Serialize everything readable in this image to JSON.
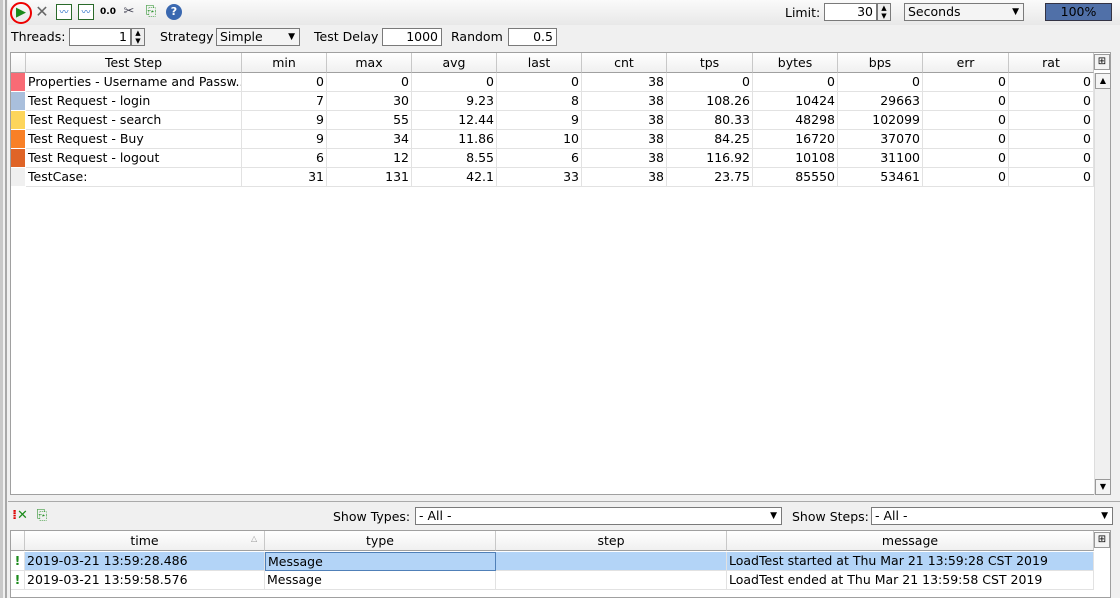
{
  "toolbar": {
    "icons": [
      "run-icon",
      "cancel-icon",
      "statistics-graph-icon",
      "statistics-history-icon",
      "reset-icon",
      "options-icon",
      "export-icon",
      "help-icon"
    ],
    "reset_label": "0.0",
    "limit_label": "Limit:",
    "limit_value": "30",
    "limit_unit": "Seconds",
    "progress": "100%",
    "progress_value": 100
  },
  "settings": {
    "threads_label": "Threads:",
    "threads": "1",
    "strategy_label": "Strategy",
    "strategy": "Simple",
    "delay_label": "Test Delay",
    "delay": "1000",
    "random_label": "Random",
    "random": "0.5"
  },
  "stats": {
    "columns": [
      "Test Step",
      "min",
      "max",
      "avg",
      "last",
      "cnt",
      "tps",
      "bytes",
      "bps",
      "err",
      "rat"
    ],
    "rows": [
      {
        "color": "#f86b75",
        "cells": [
          "Properties - Username and Passw...",
          "0",
          "0",
          "0",
          "0",
          "38",
          "0",
          "0",
          "0",
          "0",
          "0"
        ]
      },
      {
        "color": "#a9bfdc",
        "cells": [
          "Test Request - login",
          "7",
          "30",
          "9.23",
          "8",
          "38",
          "108.26",
          "10424",
          "29663",
          "0",
          "0"
        ]
      },
      {
        "color": "#fdd55a",
        "cells": [
          "Test Request - search",
          "9",
          "55",
          "12.44",
          "9",
          "38",
          "80.33",
          "48298",
          "102099",
          "0",
          "0"
        ]
      },
      {
        "color": "#f98026",
        "cells": [
          "Test Request - Buy",
          "9",
          "34",
          "11.86",
          "10",
          "38",
          "84.25",
          "16720",
          "37070",
          "0",
          "0"
        ]
      },
      {
        "color": "#df6427",
        "cells": [
          "Test Request - logout",
          "6",
          "12",
          "8.55",
          "6",
          "38",
          "116.92",
          "10108",
          "31100",
          "0",
          "0"
        ]
      },
      {
        "color": "#f0f0f0",
        "cells": [
          "TestCase:",
          "31",
          "131",
          "42.1",
          "33",
          "38",
          "23.75",
          "85550",
          "53461",
          "0",
          "0"
        ]
      }
    ]
  },
  "log": {
    "show_types_label": "Show Types:",
    "show_types": "- All -",
    "show_steps_label": "Show Steps:",
    "show_steps": "- All -",
    "columns": [
      "time",
      "type",
      "step",
      "message"
    ],
    "rows": [
      {
        "cells": [
          "2019-03-21 13:59:28.486",
          "Message",
          "",
          "LoadTest started at Thu Mar 21 13:59:28 CST 2019"
        ],
        "selected": true
      },
      {
        "cells": [
          "2019-03-21 13:59:58.576",
          "Message",
          "",
          "LoadTest ended at Thu Mar 21 13:59:58 CST 2019"
        ],
        "selected": false
      }
    ]
  },
  "colors": {
    "accent": "#5070a8",
    "selection": "#b3d4f7",
    "run": "#1a8a1a"
  }
}
